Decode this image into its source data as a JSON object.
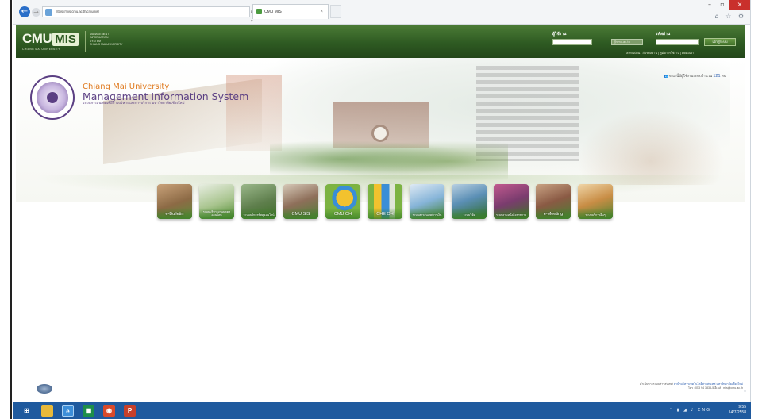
{
  "browser": {
    "url": "https://mis.cmu.ac.th/cmumis/",
    "address_tools": "ρ ▾ 🔒 C",
    "tab_title": "CMU MIS",
    "tab_close": "×",
    "controls": {
      "minimize": "–",
      "maximize": "▫",
      "close": "×"
    },
    "right_icons": "⌂ ☆ ⚙"
  },
  "header": {
    "logo_cmu": "CMU",
    "logo_mis": "MIS",
    "logo_university": "CHIANG MAI UNIVERSITY",
    "logo_description": "MANAGEMENT\nINFORMATION\nSYSTEM\nCHIANG MAI UNIVERSITY",
    "username_label": "ผู้ใช้งาน",
    "password_label": "รหัสผ่าน",
    "domain_option": "@cmu.ac.th",
    "login_button": "เข้าสู่ระบบ",
    "links": "ลงทะเบียน | ลืมรหัสผ่าน | คู่มือการใช้งาน | ติดต่อเรา"
  },
  "banner": {
    "title_en": "Chiang Mai University",
    "title_system": "Management Information System",
    "title_thai": "ระบบสารสนเทศเพื่อการบริหารและการบริการ มหาวิทยาลัยเชียงใหม่",
    "online_prefix": "👥 ขณะนี้มีผู้ใช้งานระบบจำนวน",
    "online_count": "121",
    "online_suffix": "คน"
  },
  "tiles": [
    {
      "label": "e-Bulletin",
      "icon": "books-icon"
    },
    {
      "label": "ระบบบริหารงานบุคคลออนไลน์",
      "icon": "documents-icon"
    },
    {
      "label": "ระบบบริหารพัสดุออนไลน์",
      "icon": "meeting-icon"
    },
    {
      "label": "CMU SIS",
      "icon": "students-icon"
    },
    {
      "label": "CMU OH",
      "icon": "pie-chart-icon"
    },
    {
      "label": "CHE OH",
      "icon": "bar-chart-icon"
    },
    {
      "label": "ระบบสารสนเทศการเงิน",
      "icon": "finance-icon"
    },
    {
      "label": "ระบบวิจัย",
      "icon": "lab-icon"
    },
    {
      "label": "ระบบงานหนังสือราชการ",
      "icon": "files-icon"
    },
    {
      "label": "e-Meeting",
      "icon": "conference-icon"
    },
    {
      "label": "ระบบบริการอื่นๆ",
      "icon": "services-icon"
    }
  ],
  "footer": {
    "line1_prefix": "ดำเนินการระบบสารสนเทศ",
    "line1_highlight": "สำนักบริหารเทคโนโลยีสารสนเทศ มหาวิทยาลัยเชียงใหม่",
    "line2": "โทร : 053 94 3833-5 อีเมล์ : mis@cmu.ac.th"
  },
  "taskbar": {
    "tray_lang": "ENG",
    "tray_time": "9:55",
    "tray_date": "14/7/2558"
  },
  "colors": {
    "header_green": "#2e5a22",
    "title_orange": "#e07a1f",
    "title_purple": "#5b3f83",
    "taskbar_blue": "#1f5a9e"
  }
}
